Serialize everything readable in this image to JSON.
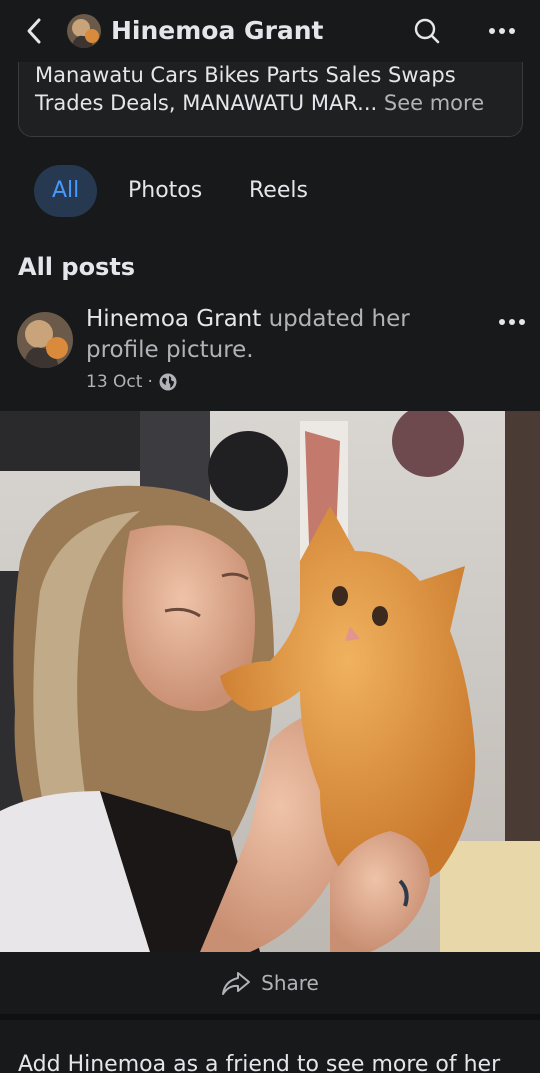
{
  "header": {
    "title": "Hinemoa Grant",
    "back_icon": "chevron-left-icon",
    "search_icon": "search-icon",
    "more_icon": "more-horizontal-icon"
  },
  "intro": {
    "text": "Manawatu Cars Bikes Parts Sales Swaps Trades Deals, MANAWATU MAR...",
    "see_more": "See more"
  },
  "tabs": [
    {
      "label": "All",
      "active": true
    },
    {
      "label": "Photos",
      "active": false
    },
    {
      "label": "Reels",
      "active": false
    }
  ],
  "section": {
    "title": "All posts"
  },
  "post": {
    "author": "Hinemoa Grant",
    "action": "updated her profile picture.",
    "date": "13 Oct",
    "separator": "·",
    "visibility_icon": "globe-icon"
  },
  "actions": {
    "share_label": "Share"
  },
  "footer": {
    "friend_prompt": "Add Hinemoa as a friend to see more of her"
  },
  "colors": {
    "background": "#18191a",
    "accent": "#4599ff",
    "active_tab_bg": "#263951",
    "secondary_text": "#b0b3b8"
  }
}
